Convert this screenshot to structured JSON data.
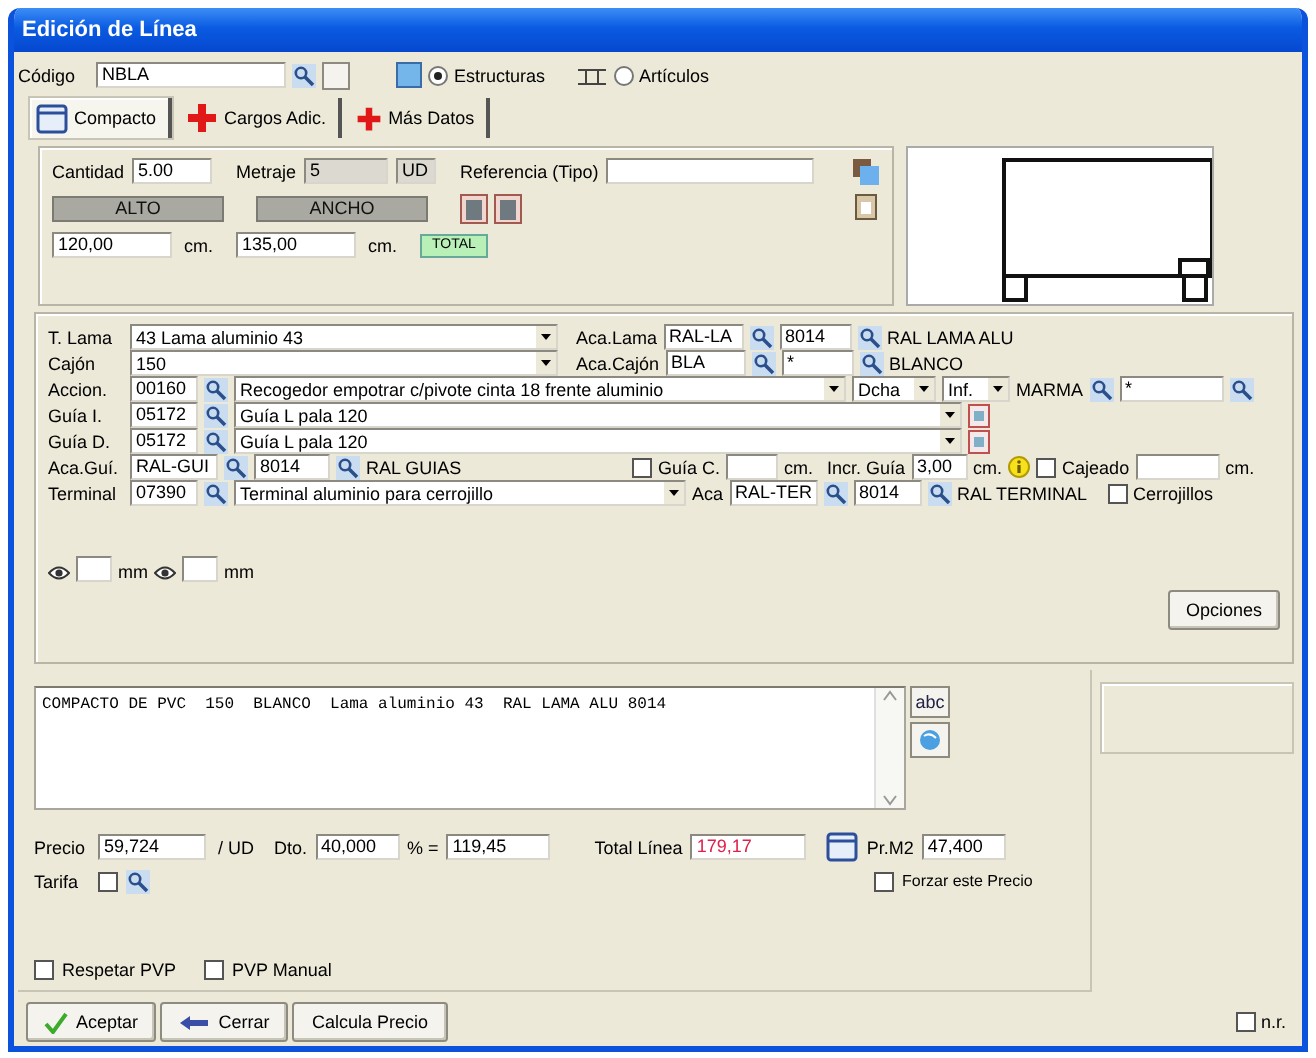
{
  "window": {
    "title": "Edición de Línea"
  },
  "header": {
    "codigo_label": "Código",
    "codigo": "NBLA",
    "modes": [
      {
        "label": "Estructuras",
        "selected": true
      },
      {
        "label": "Artículos",
        "selected": false
      }
    ]
  },
  "tabs": [
    {
      "label": "Compacto",
      "selected": true
    },
    {
      "label": "Cargos Adic.",
      "selected": false
    },
    {
      "label": "Más Datos",
      "selected": false
    }
  ],
  "measures": {
    "cantidad_label": "Cantidad",
    "cantidad": "5.00",
    "metraje_label": "Metraje",
    "metraje": "5",
    "unit": "UD",
    "referencia_label": "Referencia (Tipo)",
    "alto_label": "ALTO",
    "alto": "120,00",
    "alto_unit": "cm.",
    "ancho_label": "ANCHO",
    "ancho": "135,00",
    "ancho_unit": "cm.",
    "total": "TOTAL"
  },
  "lama": {
    "label": "T. Lama",
    "value": "43 Lama aluminio 43",
    "aca_label": "Aca.Lama",
    "aca": "RAL-LA",
    "color_code": "8014",
    "color_name": "RAL LAMA ALU"
  },
  "cajon": {
    "label": "Cajón",
    "value": "150",
    "aca_label": "Aca.Cajón",
    "aca": "BLA",
    "color_code": "*",
    "color_name": "BLANCO"
  },
  "accion": {
    "label": "Accion.",
    "code": "00160",
    "desc": "Recogedor empotrar c/pivote cinta 18 frente aluminio",
    "side": "Dcha",
    "position": "Inf.",
    "brand": "MARMA",
    "brand_value": "*"
  },
  "guias": [
    {
      "label": "Guía I.",
      "code": "05172",
      "desc": "Guía L pala 120"
    },
    {
      "label": "Guía D.",
      "code": "05172",
      "desc": "Guía L pala 120"
    }
  ],
  "aca_guia": {
    "label": "Aca.Guí.",
    "aca": "RAL-GUI",
    "color_code": "8014",
    "color_name": "RAL GUIAS",
    "guia_c": {
      "label": "Guía C.",
      "checked": false
    },
    "guia_c_unit": "cm.",
    "incr_label": "Incr. Guía",
    "incr": "3,00",
    "incr_unit": "cm.",
    "cajeado": {
      "label": "Cajeado",
      "checked": false
    },
    "cajeado_unit": "cm."
  },
  "terminal": {
    "label": "Terminal",
    "code": "07390",
    "desc": "Terminal aluminio para cerrojillo",
    "aca_label": "Aca",
    "aca": "RAL-TER",
    "color_code": "8014",
    "color_name": "RAL TERMINAL",
    "cerrojillos": {
      "label": "Cerrojillos",
      "checked": false
    }
  },
  "offsets": {
    "unit_1": "mm",
    "unit_2": "mm"
  },
  "opciones_button": "Opciones",
  "description": "COMPACTO DE PVC  150  BLANCO  Lama aluminio 43  RAL LAMA ALU 8014",
  "abc_button": "abc",
  "price": {
    "precio_label": "Precio",
    "precio": "59,724",
    "per_unit": "/ UD",
    "dto_label": "Dto.",
    "dto": "40,000",
    "eq_label": "% =",
    "eq": "119,45",
    "total_label": "Total Línea",
    "total": "179,17",
    "m2_label": "Pr.M2",
    "m2": "47,400",
    "forzar": {
      "label": "Forzar este Precio",
      "checked": false
    },
    "tarifa_label": "Tarifa",
    "tarifa": {
      "checked": false
    }
  },
  "options": [
    {
      "label": "Respetar PVP",
      "checked": false
    },
    {
      "label": "PVP Manual",
      "checked": false
    }
  ],
  "buttons": [
    "Aceptar",
    "Cerrar",
    "Calcula Precio"
  ],
  "nr": {
    "label": "n.r.",
    "checked": false
  }
}
